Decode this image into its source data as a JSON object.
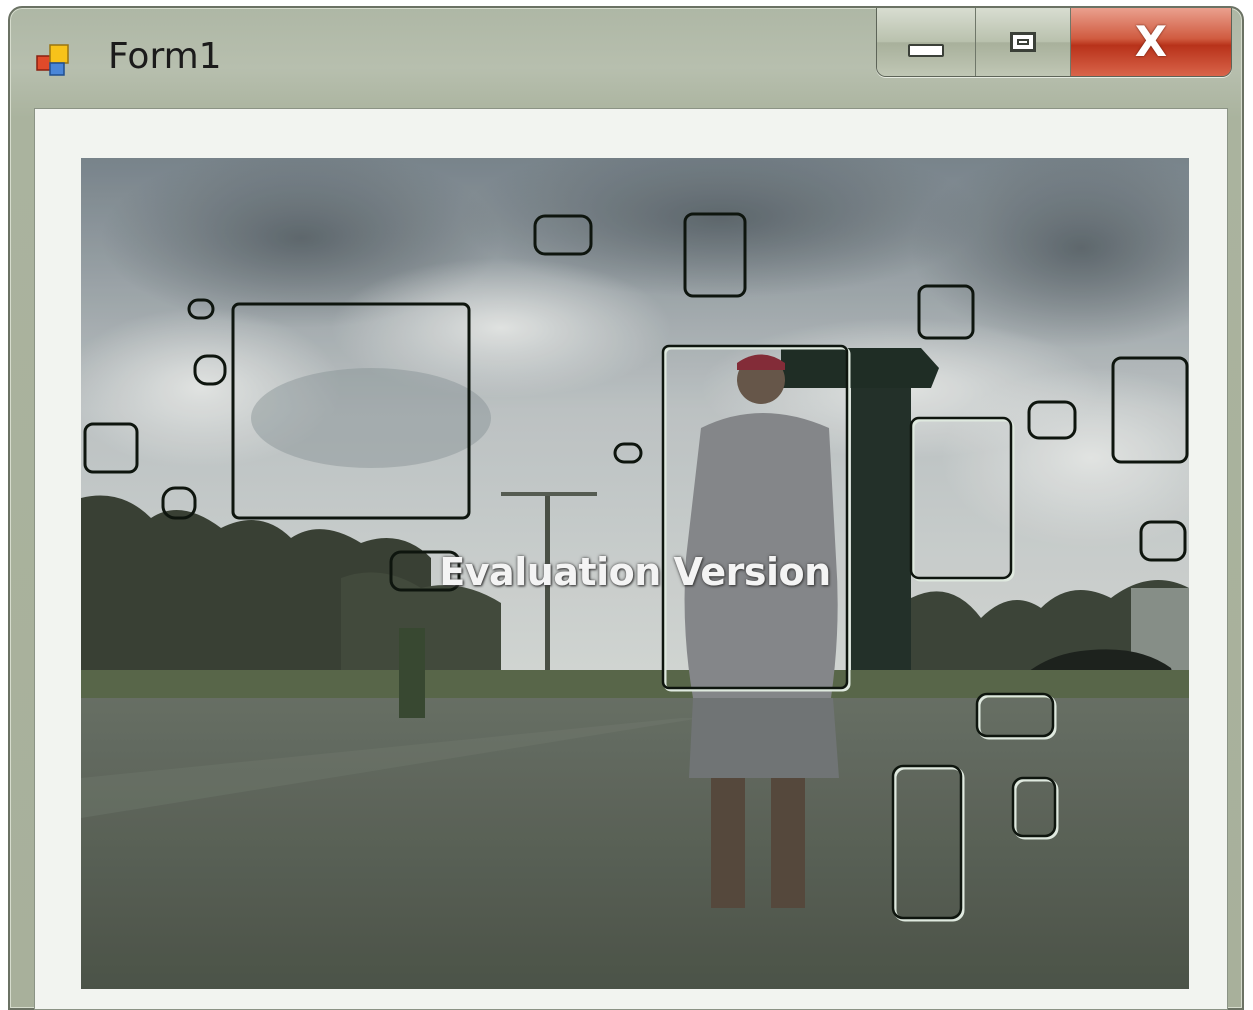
{
  "window": {
    "title": "Form1",
    "app_icon": "winforms-app-icon",
    "buttons": {
      "minimize_icon": "minimize-icon",
      "maximize_icon": "maximize-icon",
      "close_glyph": "X"
    }
  },
  "video": {
    "watermark": "Evaluation Version",
    "overlay_color": "#0e150e"
  },
  "colors": {
    "frame": "#aeb7a5",
    "close": "#c8442a",
    "client": "#f2f4f0"
  }
}
